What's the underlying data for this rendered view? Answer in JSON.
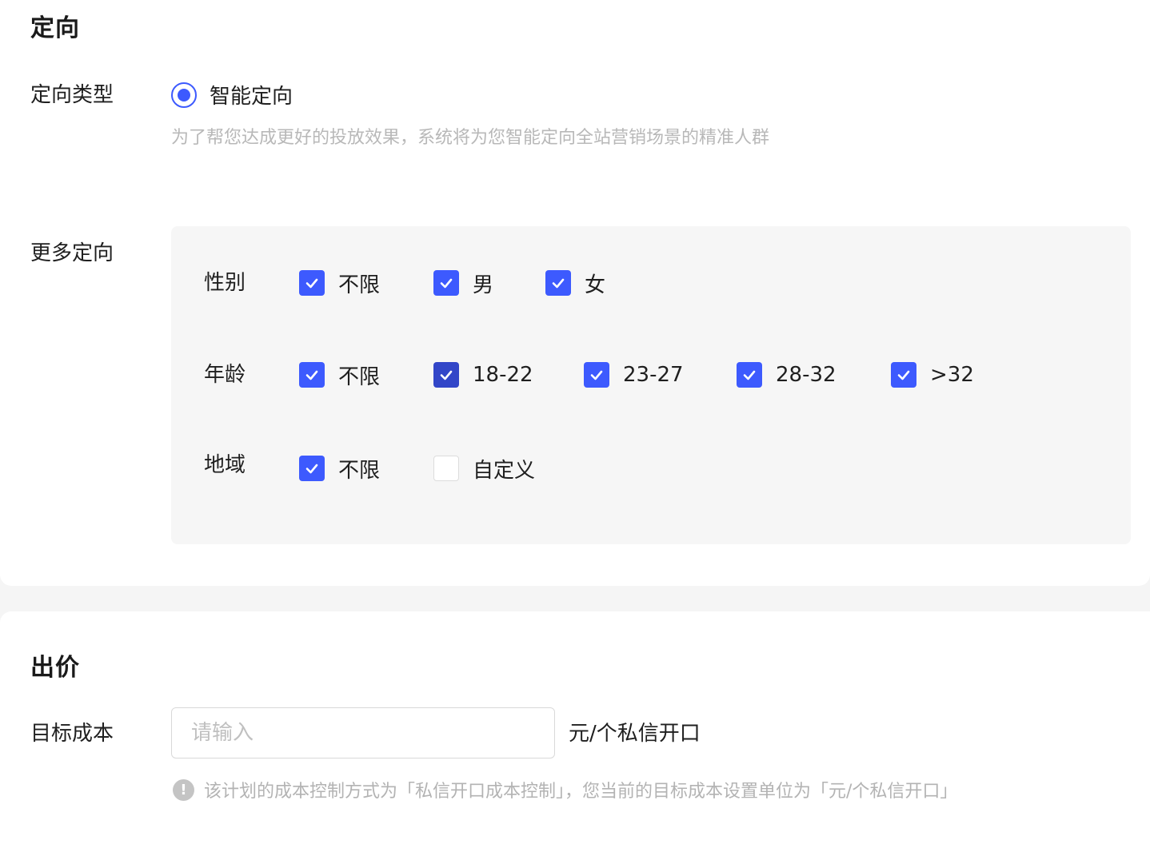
{
  "targeting": {
    "title": "定向",
    "type_label": "定向类型",
    "type_option": "智能定向",
    "type_hint": "为了帮您达成更好的投放效果，系统将为您智能定向全站营销场景的精准人群",
    "more_label": "更多定向",
    "gender": {
      "label": "性别",
      "options": [
        "不限",
        "男",
        "女"
      ]
    },
    "age": {
      "label": "年龄",
      "options": [
        "不限",
        "18-22",
        "23-27",
        "28-32",
        ">32"
      ]
    },
    "region": {
      "label": "地域",
      "options": [
        "不限",
        "自定义"
      ]
    }
  },
  "bid": {
    "title": "出价",
    "cost_label": "目标成本",
    "cost_placeholder": "请输入",
    "cost_unit": "元/个私信开口",
    "info_text": "该计划的成本控制方式为「私信开口成本控制」，您当前的目标成本设置单位为「元/个私信开口」"
  },
  "colors": {
    "primary": "#3d5afe",
    "panel_bg": "#f6f6f6",
    "hint": "#b8b8b8"
  }
}
